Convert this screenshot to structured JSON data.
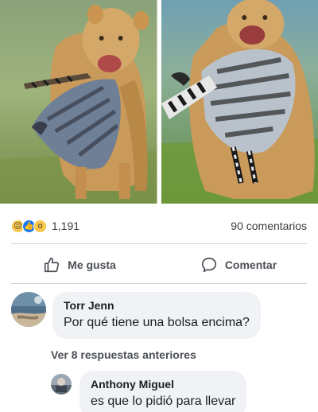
{
  "post": {
    "images": [
      {
        "icon": "lion-carrying-zebra-foal-photo"
      },
      {
        "icon": "lion-carrying-zebra-foal-closeup-photo"
      }
    ],
    "reactions": {
      "icons": [
        "sad-reaction-icon",
        "like-reaction-icon",
        "wow-reaction-icon"
      ],
      "count": "1,191"
    },
    "comments_count": "90 comentarios"
  },
  "actions": {
    "like_label": "Me gusta",
    "comment_label": "Comentar"
  },
  "comments": [
    {
      "author": "Torr Jenn",
      "text": "Por qué tiene una bolsa encima?"
    }
  ],
  "replies": {
    "more_label": "Ver 8 respuestas anteriores",
    "items": [
      {
        "author": "Anthony Miguel",
        "text": "es que lo pidió para llevar"
      }
    ]
  },
  "colors": {
    "accent": "#1877f2",
    "bubble": "#f0f2f5",
    "divider": "#ced0d4",
    "muted_text": "#4b4f56"
  }
}
